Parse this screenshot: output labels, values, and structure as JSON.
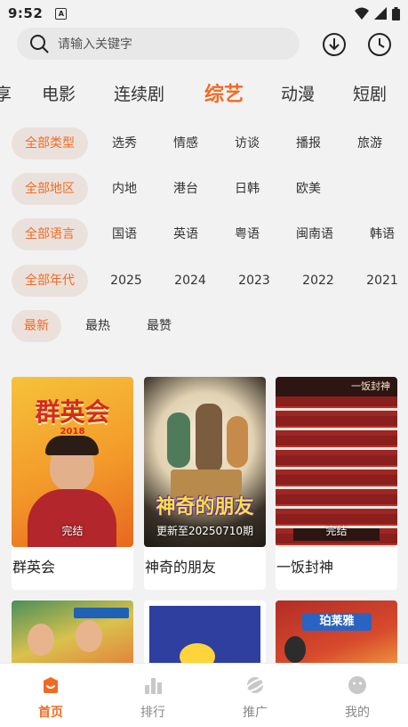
{
  "status_bar": {
    "time": "9:52",
    "notif_letter": "A"
  },
  "search": {
    "placeholder": "请输入关键字"
  },
  "category_tabs": [
    "享",
    "电影",
    "连续剧",
    "综艺",
    "动漫",
    "短剧"
  ],
  "active_tab": "综艺",
  "filters": {
    "type": [
      "全部类型",
      "选秀",
      "情感",
      "访谈",
      "播报",
      "旅游"
    ],
    "region": [
      "全部地区",
      "内地",
      "港台",
      "日韩",
      "欧美"
    ],
    "language": [
      "全部语言",
      "国语",
      "英语",
      "粤语",
      "闽南语",
      "韩语"
    ],
    "year": [
      "全部年代",
      "2025",
      "2024",
      "2023",
      "2022",
      "2021"
    ],
    "sort": [
      "最新",
      "最热",
      "最赞"
    ]
  },
  "cards": [
    {
      "title": "群英会",
      "status": "完结",
      "poster_text": "群英会",
      "poster_sub": "2018"
    },
    {
      "title": "神奇的朋友",
      "status": "更新至20250710期",
      "poster_text": "神奇的朋友"
    },
    {
      "title": "一饭封神",
      "status": "完结",
      "poster_text": "一饭封神"
    }
  ],
  "cards_row2": [
    {
      "poster_text": ""
    },
    {
      "poster_text": ""
    },
    {
      "poster_text": "珀莱雅"
    }
  ],
  "bottom_nav": [
    "首页",
    "排行",
    "推广",
    "我的"
  ],
  "colors": {
    "accent": "#f26a22",
    "chip_bg": "#ebe1dc",
    "page_bg": "#f2f2f2"
  }
}
